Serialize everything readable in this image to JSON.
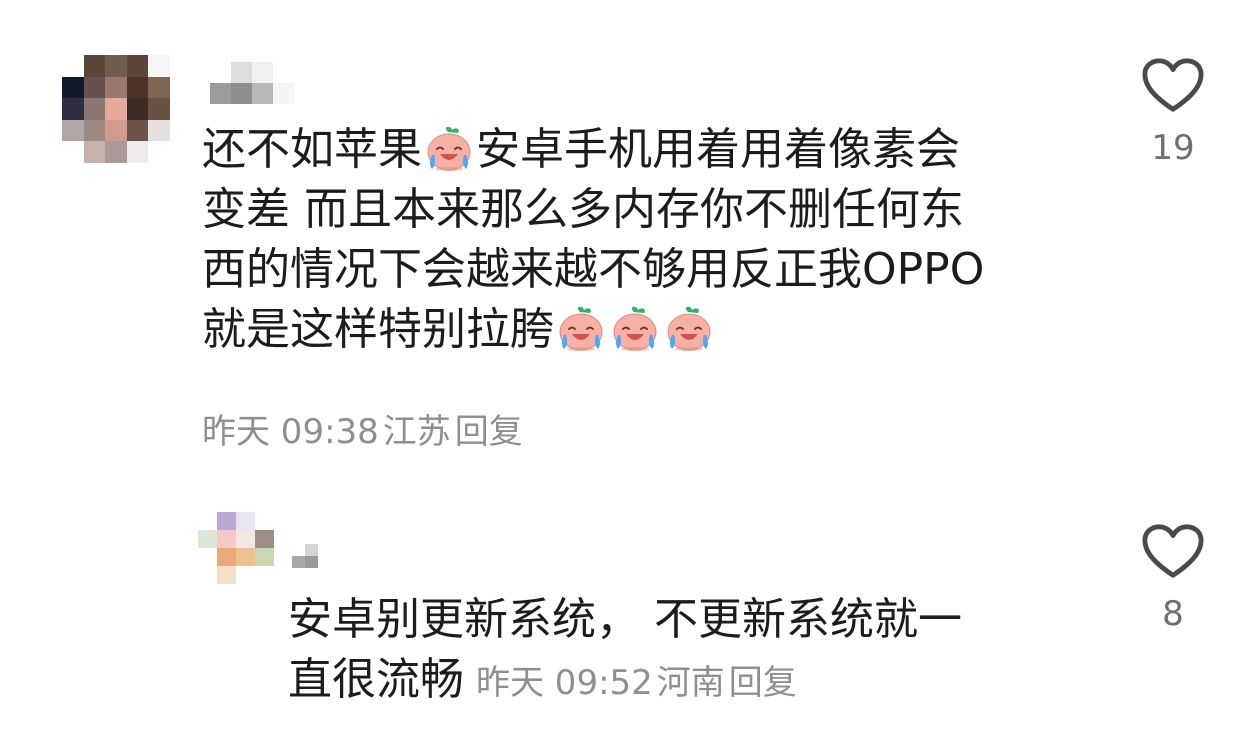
{
  "comment": {
    "lines": [
      "还不如苹果",
      "安卓手机用着用着像素会",
      "变差 而且本来那么多内存你不删任何东",
      "西的情况下会越来越不够用反正我OPPO",
      "就是这样特别拉胯"
    ],
    "emoji_icon": "crying-peach-emoji",
    "time": "昨天 09:38",
    "location": "江苏",
    "reply_label": "回复",
    "like_count": "19",
    "like_icon": "heart-outline-icon"
  },
  "reply": {
    "lines": [
      "安卓别更新系统， 不更新系统就一",
      "直很流畅"
    ],
    "time": "昨天 09:52",
    "location": "河南",
    "reply_label": "回复",
    "like_count": "8",
    "like_icon": "heart-outline-icon"
  }
}
